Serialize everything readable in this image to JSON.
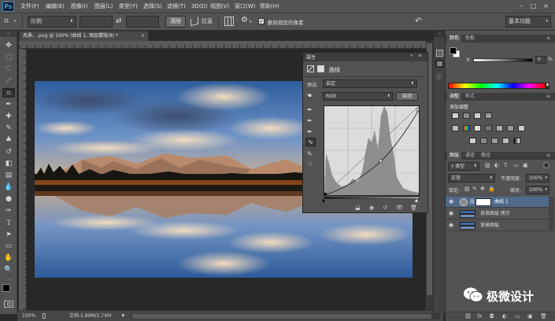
{
  "menubar": {
    "logo": "Ps",
    "items": [
      "文件(F)",
      "编辑(E)",
      "图像(I)",
      "图层(L)",
      "类型(Y)",
      "选择(S)",
      "滤镜(T)",
      "3D(D)",
      "视图(V)",
      "窗口(W)",
      "帮助(H)"
    ],
    "window_controls": [
      "–",
      "□",
      "×"
    ]
  },
  "options": {
    "crop_preset": "比例",
    "swap_icon": "⇄",
    "clear_label": "清除",
    "straighten_label": "拉直",
    "delete_pixels_label": "删除裁剪的像素",
    "workspace": "基本功能"
  },
  "document": {
    "tab_title": "风景。.png @ 100% (曲线 1, 图层蒙版/8) *",
    "zoom": "100%",
    "doc_info": "文档:1.89M/2.74M"
  },
  "properties": {
    "panel_title": "属性",
    "adjustment_name": "曲线",
    "preset_label": "预设:",
    "preset_value": "自定",
    "channel_value": "RGB",
    "auto_label": "自动"
  },
  "color_panel": {
    "tabs": [
      "颜色",
      "色板"
    ],
    "k_label": "K",
    "k_value": "0",
    "k_unit": "%"
  },
  "adjustments_panel": {
    "tabs": [
      "调整",
      "样式"
    ],
    "heading": "添加调整"
  },
  "layers_panel": {
    "tabs": [
      "图层",
      "通道",
      "路径"
    ],
    "kind_filter": "类型",
    "blend_mode": "正常",
    "opacity_label": "不透明度:",
    "opacity_value": "100%",
    "lock_label": "锁定:",
    "fill_label": "填充:",
    "fill_value": "100%",
    "layers": [
      {
        "name": "曲线 1",
        "selected": true
      },
      {
        "name": "背景图层 拷贝",
        "selected": false
      },
      {
        "name": "背景图层",
        "selected": false
      }
    ]
  },
  "watermark": {
    "text": "极微设计"
  },
  "colors": {
    "accent": "#2d6fb8",
    "panel": "#535353",
    "selected_layer": "#506a8c"
  }
}
